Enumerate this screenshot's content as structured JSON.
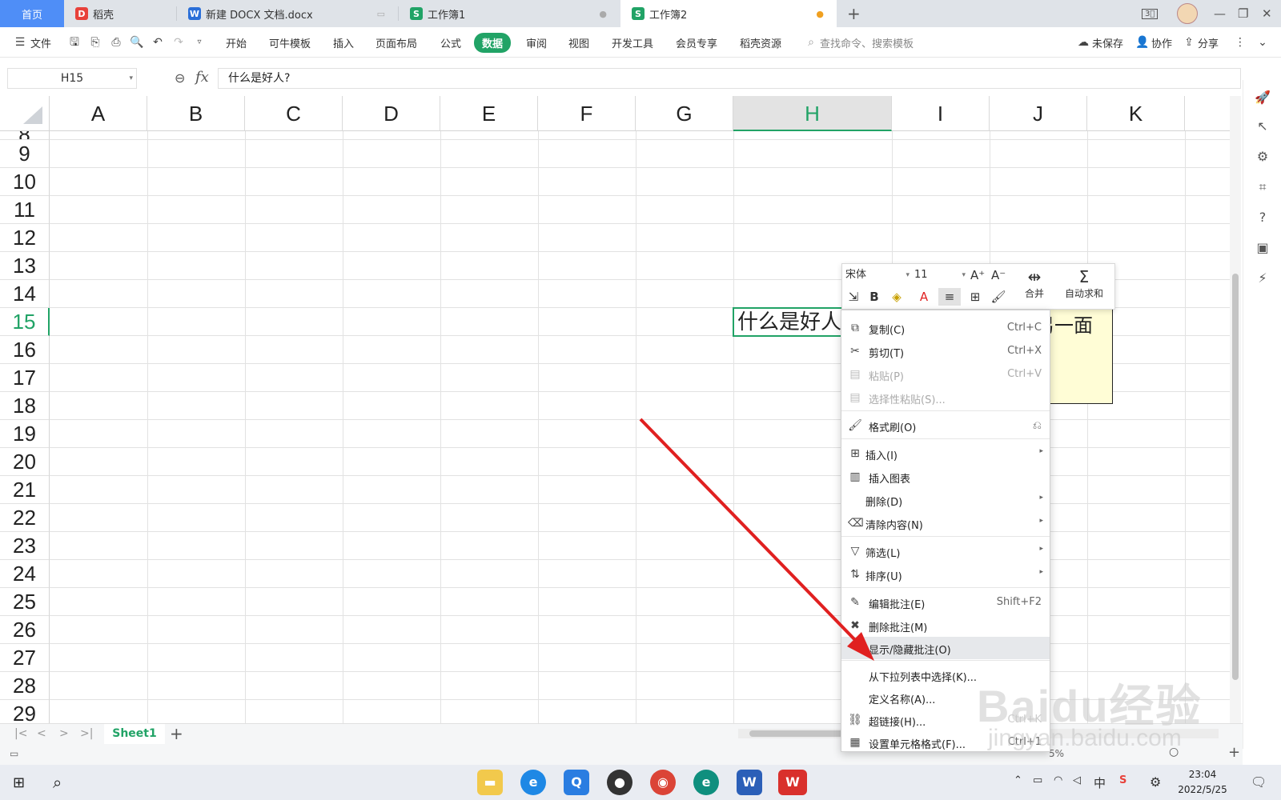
{
  "tabs": {
    "home": "首页",
    "items": [
      {
        "label": "稻壳",
        "color": "#e8413a",
        "glyph": "D"
      },
      {
        "label": "新建 DOCX 文档.docx",
        "color": "#2b6fd8",
        "glyph": "W"
      },
      {
        "label": "工作簿1",
        "color": "#21a366",
        "glyph": "S"
      },
      {
        "label": "工作簿2",
        "color": "#21a366",
        "glyph": "S"
      }
    ],
    "new_tab": "+"
  },
  "menubar": {
    "file": "文件",
    "items": [
      "开始",
      "可牛模板",
      "插入",
      "页面布局",
      "公式",
      "数据",
      "审阅",
      "视图",
      "开发工具",
      "会员专享",
      "稻壳资源"
    ],
    "active": "数据",
    "search_placeholder": "查找命令、搜索模板",
    "unsaved": "未保存",
    "collab": "协作",
    "share": "分享"
  },
  "formula_bar": {
    "name_box": "H15",
    "fx": "fx",
    "value": "什么是好人?"
  },
  "grid": {
    "columns": [
      "A",
      "B",
      "C",
      "D",
      "E",
      "F",
      "G",
      "H",
      "I",
      "J",
      "K"
    ],
    "selected_column": "H",
    "rows": [
      "8",
      "9",
      "10",
      "11",
      "12",
      "13",
      "14",
      "15",
      "16",
      "17",
      "18",
      "19",
      "20",
      "21",
      "22",
      "23",
      "24",
      "25",
      "26",
      "27",
      "28",
      "29"
    ],
    "selected_row": "15",
    "active_cell_text": "什么是好人?",
    "comment_text": "好人是坏人的另一面"
  },
  "mini_toolbar": {
    "font": "宋体",
    "size": "11",
    "merge": "合并",
    "autosum": "自动求和"
  },
  "context_menu": [
    {
      "label": "复制(C)",
      "shortcut": "Ctrl+C",
      "icon": "copy-icon",
      "glyph": "⧉"
    },
    {
      "label": "剪切(T)",
      "shortcut": "Ctrl+X",
      "icon": "scissors-icon",
      "glyph": "✂"
    },
    {
      "label": "粘贴(P)",
      "shortcut": "Ctrl+V",
      "icon": "paste-icon",
      "glyph": "📋",
      "disabled": true
    },
    {
      "label": "选择性粘贴(S)...",
      "shortcut": "",
      "icon": "paste-special-icon",
      "glyph": "📋",
      "disabled": true
    },
    {
      "label": "格式刷(O)",
      "shortcut": "",
      "icon": "format-brush-icon",
      "glyph": "🖌"
    },
    {
      "label": "插入(I)",
      "shortcut": "",
      "icon": "insert-icon",
      "glyph": "⊞",
      "submenu": true
    },
    {
      "label": "插入图表",
      "shortcut": "",
      "icon": "chart-icon",
      "glyph": "▥"
    },
    {
      "label": "删除(D)",
      "shortcut": "",
      "icon": "",
      "glyph": "",
      "submenu": true
    },
    {
      "label": "清除内容(N)",
      "shortcut": "",
      "icon": "eraser-icon",
      "glyph": "⌫",
      "submenu": true
    },
    {
      "label": "筛选(L)",
      "shortcut": "",
      "icon": "filter-icon",
      "glyph": "▽",
      "submenu": true
    },
    {
      "label": "排序(U)",
      "shortcut": "",
      "icon": "sort-icon",
      "glyph": "⇅",
      "submenu": true
    },
    {
      "label": "编辑批注(E)",
      "shortcut": "Shift+F2",
      "icon": "edit-comment-icon",
      "glyph": "✎"
    },
    {
      "label": "删除批注(M)",
      "shortcut": "",
      "icon": "delete-comment-icon",
      "glyph": "✖"
    },
    {
      "label": "显示/隐藏批注(O)",
      "shortcut": "",
      "icon": "",
      "glyph": "",
      "highlight": true
    },
    {
      "label": "从下拉列表中选择(K)...",
      "shortcut": "",
      "icon": "",
      "glyph": ""
    },
    {
      "label": "定义名称(A)...",
      "shortcut": "",
      "icon": "",
      "glyph": ""
    },
    {
      "label": "超链接(H)...",
      "shortcut": "Ctrl+K",
      "icon": "link-icon",
      "glyph": "🔗"
    },
    {
      "label": "设置单元格格式(F)...",
      "shortcut": "Ctrl+1",
      "icon": "format-cells-icon",
      "glyph": "▦"
    }
  ],
  "sheet": {
    "active_tab": "Sheet1",
    "add": "+",
    "zoom": "5%"
  },
  "taskbar": {
    "time": "23:04",
    "date": "2022/5/25",
    "ime": "中"
  },
  "watermark": {
    "brand": "Baidu经验",
    "url": "jingyan.baidu.com"
  },
  "colors": {
    "accent": "#21a366",
    "home_tab": "#4f8ef7",
    "comment_bg": "#fffdd6",
    "arrow": "#e02020"
  }
}
